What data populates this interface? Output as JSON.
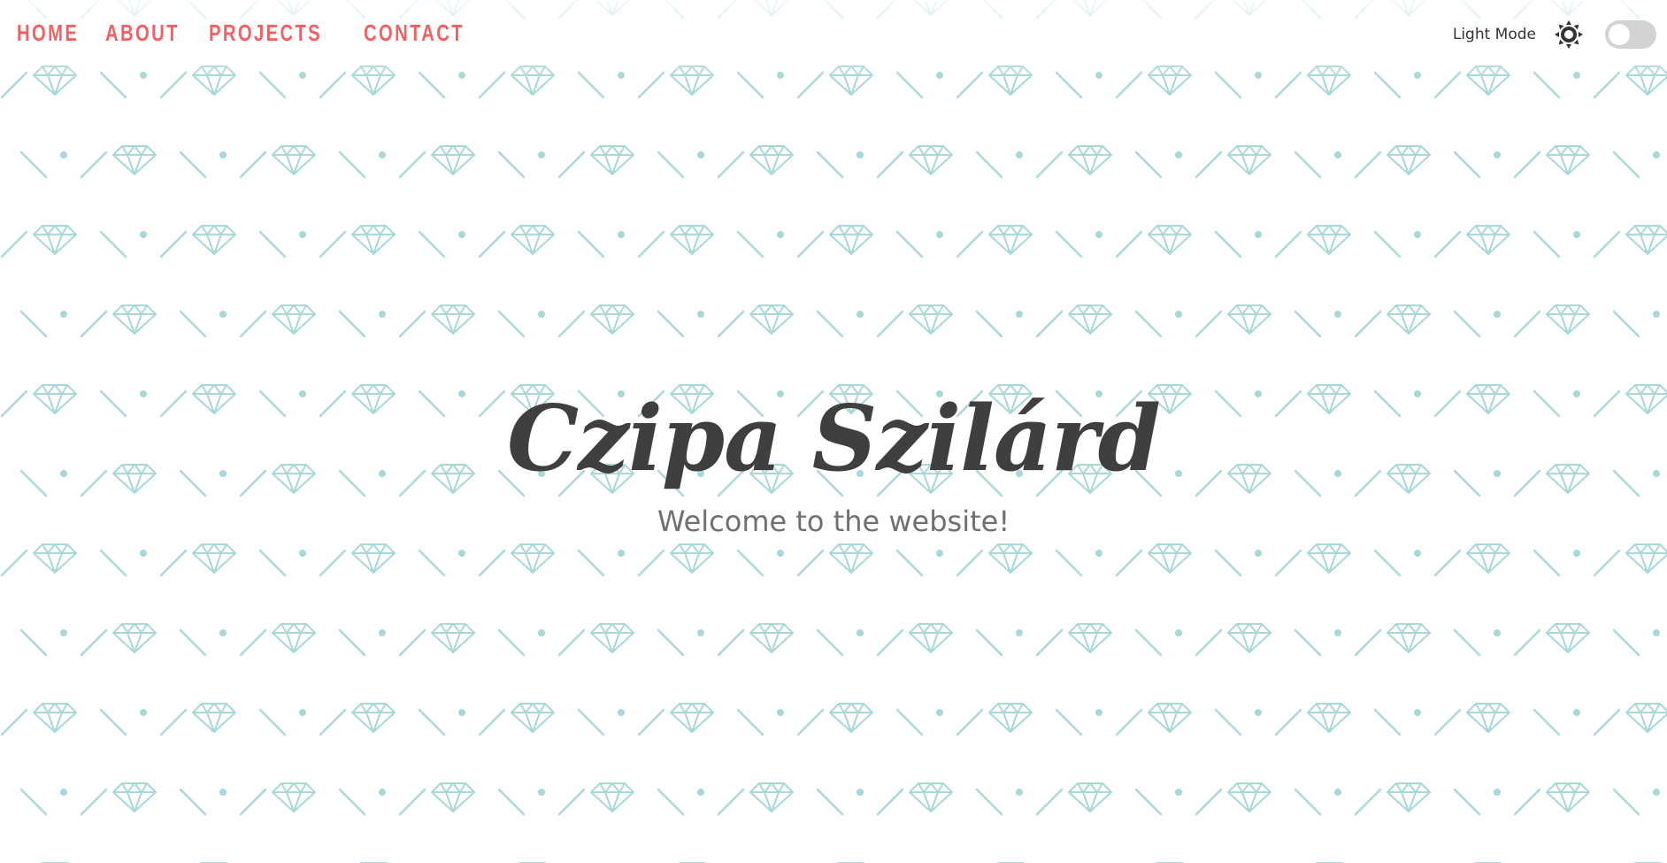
{
  "nav": {
    "items": [
      {
        "label": "HOME"
      },
      {
        "label": "ABOUT"
      },
      {
        "label": "PROJECTS"
      },
      {
        "label": "CONTACT"
      }
    ]
  },
  "theme": {
    "mode_label": "Light Mode",
    "toggle_on": false,
    "icon": "sun-icon"
  },
  "hero": {
    "title": "Czipa Szilárd",
    "subtitle": "Welcome to the website!"
  },
  "background": {
    "pattern_icon": "diamond-icon"
  },
  "colors": {
    "accent": "#f16163",
    "pattern": "#a8d8d8",
    "title": "#3f3f3f",
    "subtitle": "#707070",
    "toggle_track": "#d3d3d3"
  }
}
